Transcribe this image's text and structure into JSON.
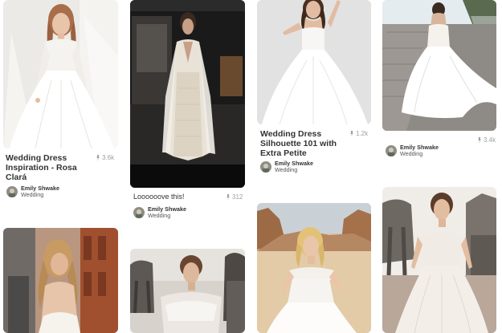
{
  "pins": [
    {
      "id": "pin-1",
      "title": "Wedding Dress Inspiration - Rosa Clará",
      "saves": "3.6k",
      "user": "Emily Shwake",
      "board": "Wedding",
      "scene": "white studio, lace long-sleeve gown, long veil"
    },
    {
      "id": "pin-2",
      "title": "",
      "description": "Loooooove this!",
      "saves": "312",
      "user": "Emily Shwake",
      "board": "Wedding",
      "scene": "dark room, plunging lace gown with cape"
    },
    {
      "id": "pin-3",
      "title": "Wedding Dress Silhouette 101 with Extra Petite",
      "saves": "1.2k",
      "user": "Emily Shwake",
      "board": "Wedding",
      "scene": "grey studio, strapless tulle ball gown"
    },
    {
      "id": "pin-4",
      "title": "",
      "saves": "3.4k",
      "user": "Emily Shwake",
      "board": "Wedding",
      "scene": "stone path, strapless ball gown walking away"
    },
    {
      "id": "pin-5",
      "scene": "brick street, open-back gown"
    },
    {
      "id": "pin-6",
      "scene": "ancient ruins, off-shoulder lace gown"
    },
    {
      "id": "pin-7",
      "scene": "desert canyon, off-shoulder gown"
    },
    {
      "id": "pin-8",
      "scene": "ancient ruins, elephant statue, off-shoulder lace gown"
    }
  ],
  "icons": {
    "saves": "pin-icon"
  },
  "colors": {
    "text": "#333333",
    "muted": "#a0a0a0",
    "background": "#ffffff"
  }
}
